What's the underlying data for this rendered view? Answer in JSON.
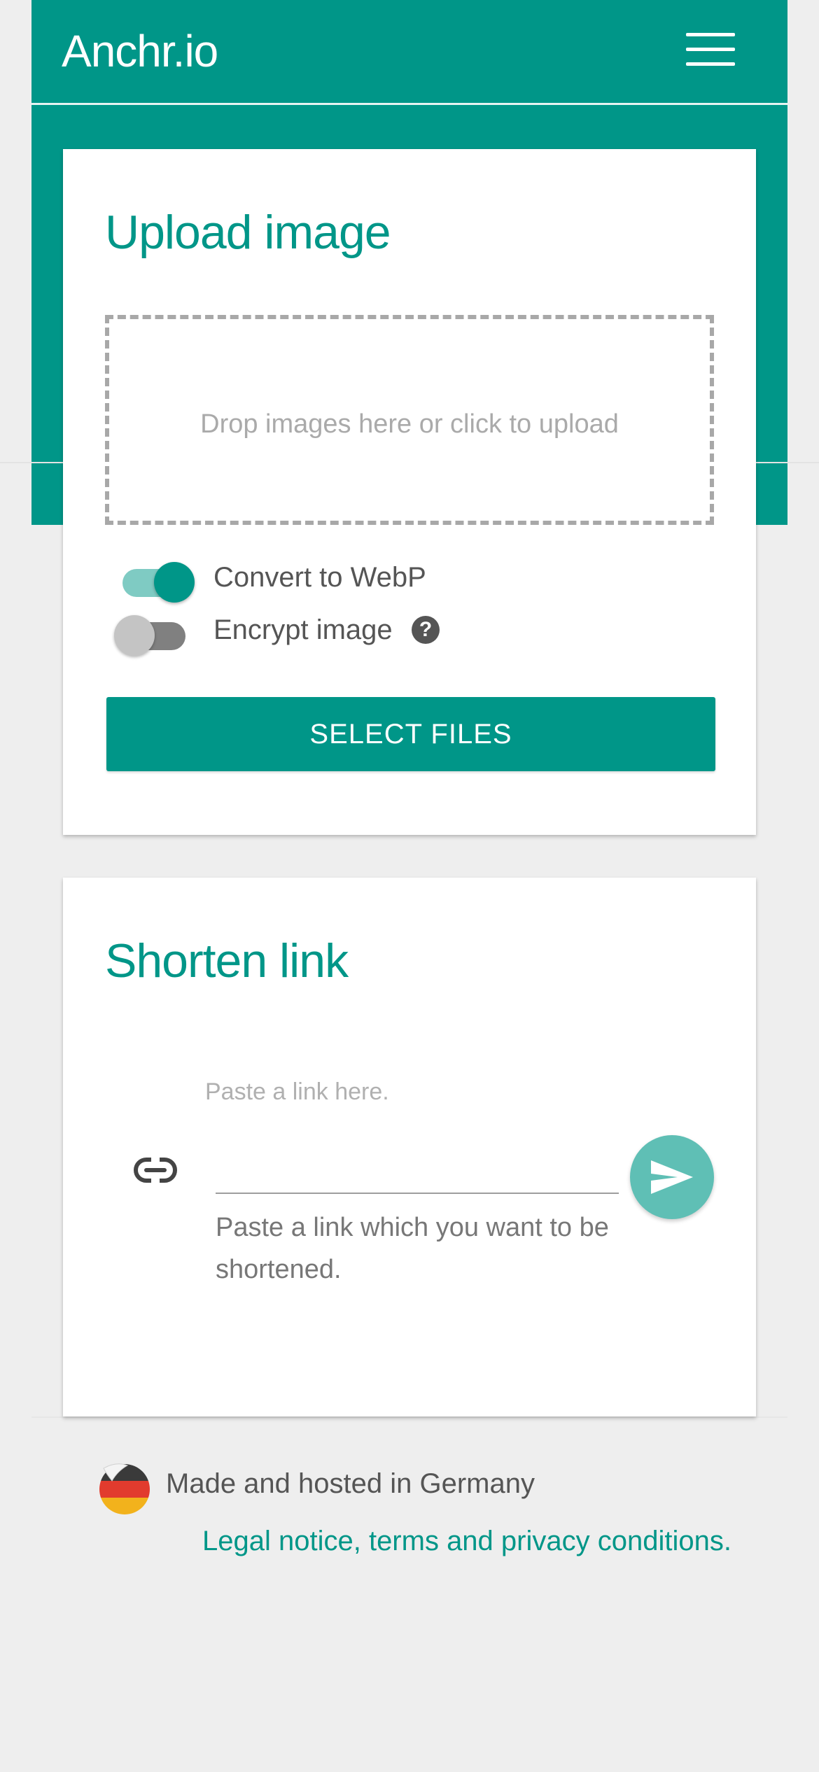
{
  "header": {
    "brand": "Anchr.io",
    "menu_icon": "hamburger-menu-icon",
    "color": "#009688"
  },
  "upload_card": {
    "title": "Upload image",
    "dropzone_text": "Drop images here or click to upload",
    "toggles": [
      {
        "label": "Convert to WebP",
        "checked": true
      },
      {
        "label": "Encrypt image",
        "checked": false
      }
    ],
    "help_icon": "question-circle-icon",
    "help_glyph": "?",
    "select_button": "SELECT FILES"
  },
  "shorten_card": {
    "title": "Shorten link",
    "input_label": "Paste a link here.",
    "input_value": "",
    "helper_text": "Paste a link which you want to be shortened.",
    "link_icon": "link-icon",
    "send_icon": "send-icon"
  },
  "footer": {
    "made_text": "Made and hosted in Germany",
    "flag_icon": "germany-flag-icon",
    "legal_link": "Legal notice, terms and privacy conditions."
  }
}
